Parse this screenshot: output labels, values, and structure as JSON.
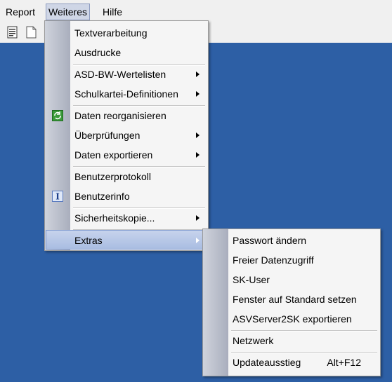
{
  "menubar": {
    "items": [
      {
        "label": "Report"
      },
      {
        "label": "Weiteres"
      },
      {
        "label": "Hilfe"
      }
    ]
  },
  "toolbar": {
    "icons": [
      "report-icon",
      "document-icon"
    ]
  },
  "weiteres_menu": {
    "items": [
      {
        "label": "Textverarbeitung"
      },
      {
        "label": "Ausdrucke"
      },
      {
        "label": "ASD-BW-Wertelisten"
      },
      {
        "label": "Schulkartei-Definitionen"
      },
      {
        "label": "Daten reorganisieren"
      },
      {
        "label": "Überprüfungen"
      },
      {
        "label": "Daten exportieren"
      },
      {
        "label": "Benutzerprotokoll"
      },
      {
        "label": "Benutzerinfo"
      },
      {
        "label": "Sicherheitskopie..."
      },
      {
        "label": "Extras"
      }
    ]
  },
  "extras_submenu": {
    "items": [
      {
        "label": "Passwort ändern"
      },
      {
        "label": "Freier Datenzugriff"
      },
      {
        "label": "SK-User"
      },
      {
        "label": "Fenster auf Standard setzen"
      },
      {
        "label": "ASVServer2SK exportieren"
      },
      {
        "label": "Netzwerk"
      },
      {
        "label": "Updateausstieg",
        "shortcut": "Alt+F12"
      }
    ]
  },
  "colors": {
    "desktop": "#2d5fa5",
    "menu_bg": "#f5f5f5",
    "highlight": "#b8c8ea"
  }
}
